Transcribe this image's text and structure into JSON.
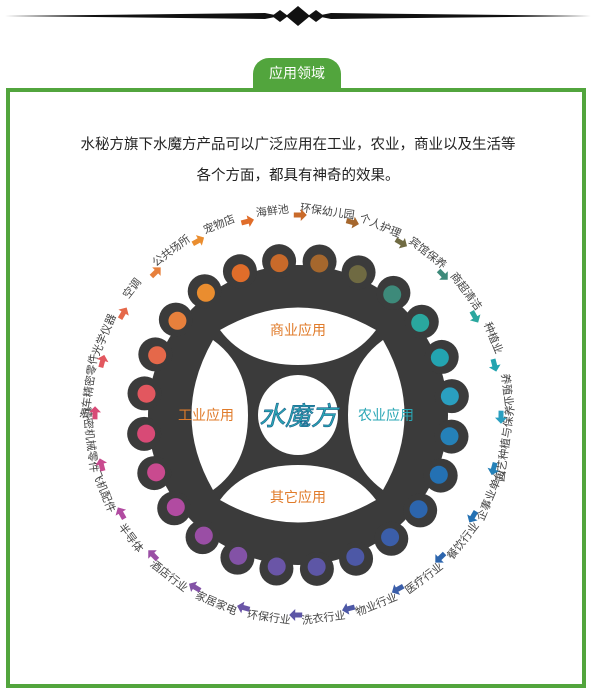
{
  "header": {
    "tab_label": "应用领域"
  },
  "intro": {
    "line1": "水秘方旗下水魔方产品可以广泛应用在工业，农业，商业以及生活等",
    "line2": "各个方面，都具有神奇的效果。"
  },
  "wheel": {
    "center_brand": "水魔方",
    "quadrants": {
      "top": "商业应用",
      "left": "工业应用",
      "right": "农业应用",
      "bottom": "其它应用"
    },
    "colors": {
      "gear": "#3b3b3b",
      "accent_orange": "#e07b2a",
      "accent_teal": "#2aa7b5",
      "frame_green": "#52a53d"
    }
  },
  "applications": [
    {
      "label": "宠物店",
      "color": "#e06d2a"
    },
    {
      "label": "海鲜池",
      "color": "#c96a2a"
    },
    {
      "label": "环保幼儿园",
      "color": "#a5672d"
    },
    {
      "label": "个人护理",
      "color": "#6f6a42"
    },
    {
      "label": "宾馆保养",
      "color": "#3d8a7a"
    },
    {
      "label": "商超清洁",
      "color": "#2aa79e"
    },
    {
      "label": "种植业",
      "color": "#23a4b0"
    },
    {
      "label": "养殖业",
      "color": "#2a9fc0"
    },
    {
      "label": "园艺种植与保养",
      "color": "#2581b8"
    },
    {
      "label": "企事业单位",
      "color": "#2471b3"
    },
    {
      "label": "餐饮行业",
      "color": "#2c65ad"
    },
    {
      "label": "医疗行业",
      "color": "#3b5ea9"
    },
    {
      "label": "物业行业",
      "color": "#4d58a6"
    },
    {
      "label": "洗衣行业",
      "color": "#5d56a6"
    },
    {
      "label": "环保行业",
      "color": "#6a55a7"
    },
    {
      "label": "家居家电",
      "color": "#8352a6"
    },
    {
      "label": "酒店行业",
      "color": "#9a4ea5"
    },
    {
      "label": "半导体",
      "color": "#b14ba1"
    },
    {
      "label": "飞机配件",
      "color": "#c94a8f"
    },
    {
      "label": "精密机械零件",
      "color": "#d84a76"
    },
    {
      "label": "汽车精密零件",
      "color": "#e2575f"
    },
    {
      "label": "光学仪器",
      "color": "#e5684a"
    },
    {
      "label": "空调",
      "color": "#e7803c"
    },
    {
      "label": "公共场所",
      "color": "#ea8d2f"
    }
  ]
}
